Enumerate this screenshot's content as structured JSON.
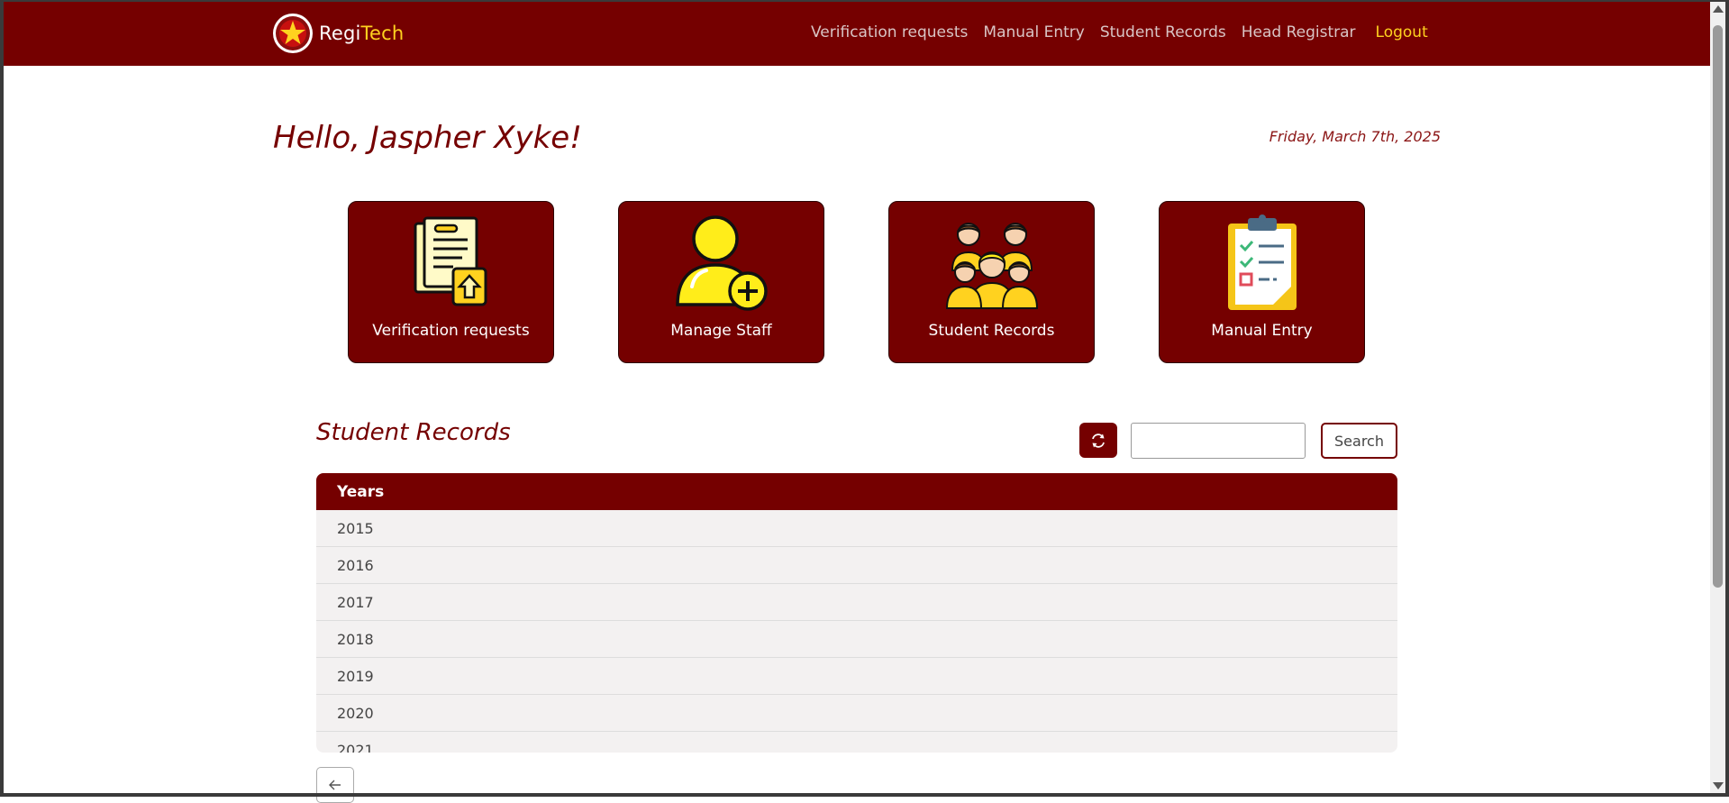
{
  "brand": {
    "prefix": "Regi",
    "accent": "Tech"
  },
  "nav": {
    "items": [
      "Verification requests",
      "Manual Entry",
      "Student Records",
      "Head Registrar"
    ],
    "logout": "Logout"
  },
  "greeting": "Hello, Jaspher Xyke!",
  "date": "Friday, March 7th, 2025",
  "cards": [
    {
      "label": "Verification requests",
      "icon": "document-upload-icon"
    },
    {
      "label": "Manage Staff",
      "icon": "add-user-icon"
    },
    {
      "label": "Student Records",
      "icon": "student-group-icon"
    },
    {
      "label": "Manual Entry",
      "icon": "clipboard-checklist-icon"
    }
  ],
  "records": {
    "title": "Student Records",
    "search_button": "Search",
    "search_value": "",
    "column": "Years",
    "years": [
      "2015",
      "2016",
      "2017",
      "2018",
      "2019",
      "2020",
      "2021"
    ]
  },
  "colors": {
    "primary": "#750000",
    "accent": "#ffd21f",
    "row_bg": "#f3f1f1"
  }
}
